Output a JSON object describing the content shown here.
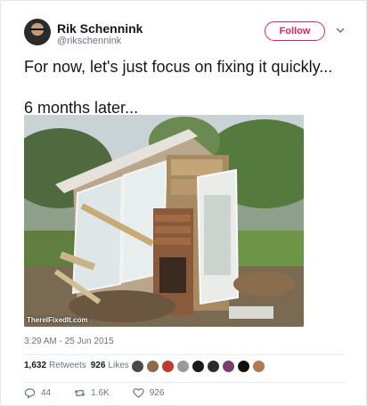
{
  "author": {
    "name": "Rik Schennink",
    "handle": "@rikschennink"
  },
  "header": {
    "follow_label": "Follow",
    "menu_icon": "chevron-down-icon"
  },
  "tweet": {
    "line1": "For now, let's just focus on fixing it quickly...",
    "line2": "6 months later...",
    "image_watermark": "ThereIFixedIt.com",
    "timestamp": "3:29 AM - 25 Jun 2015"
  },
  "stats": {
    "retweets_count": "1,632",
    "retweets_label": "Retweets",
    "likes_count": "926",
    "likes_label": "Likes"
  },
  "actions": {
    "reply_count": "44",
    "retweet_count": "1.6K",
    "like_count": "926"
  },
  "colors": {
    "accent": "#e0245e",
    "secondary_text": "#657786",
    "primary_text": "#14171a"
  }
}
